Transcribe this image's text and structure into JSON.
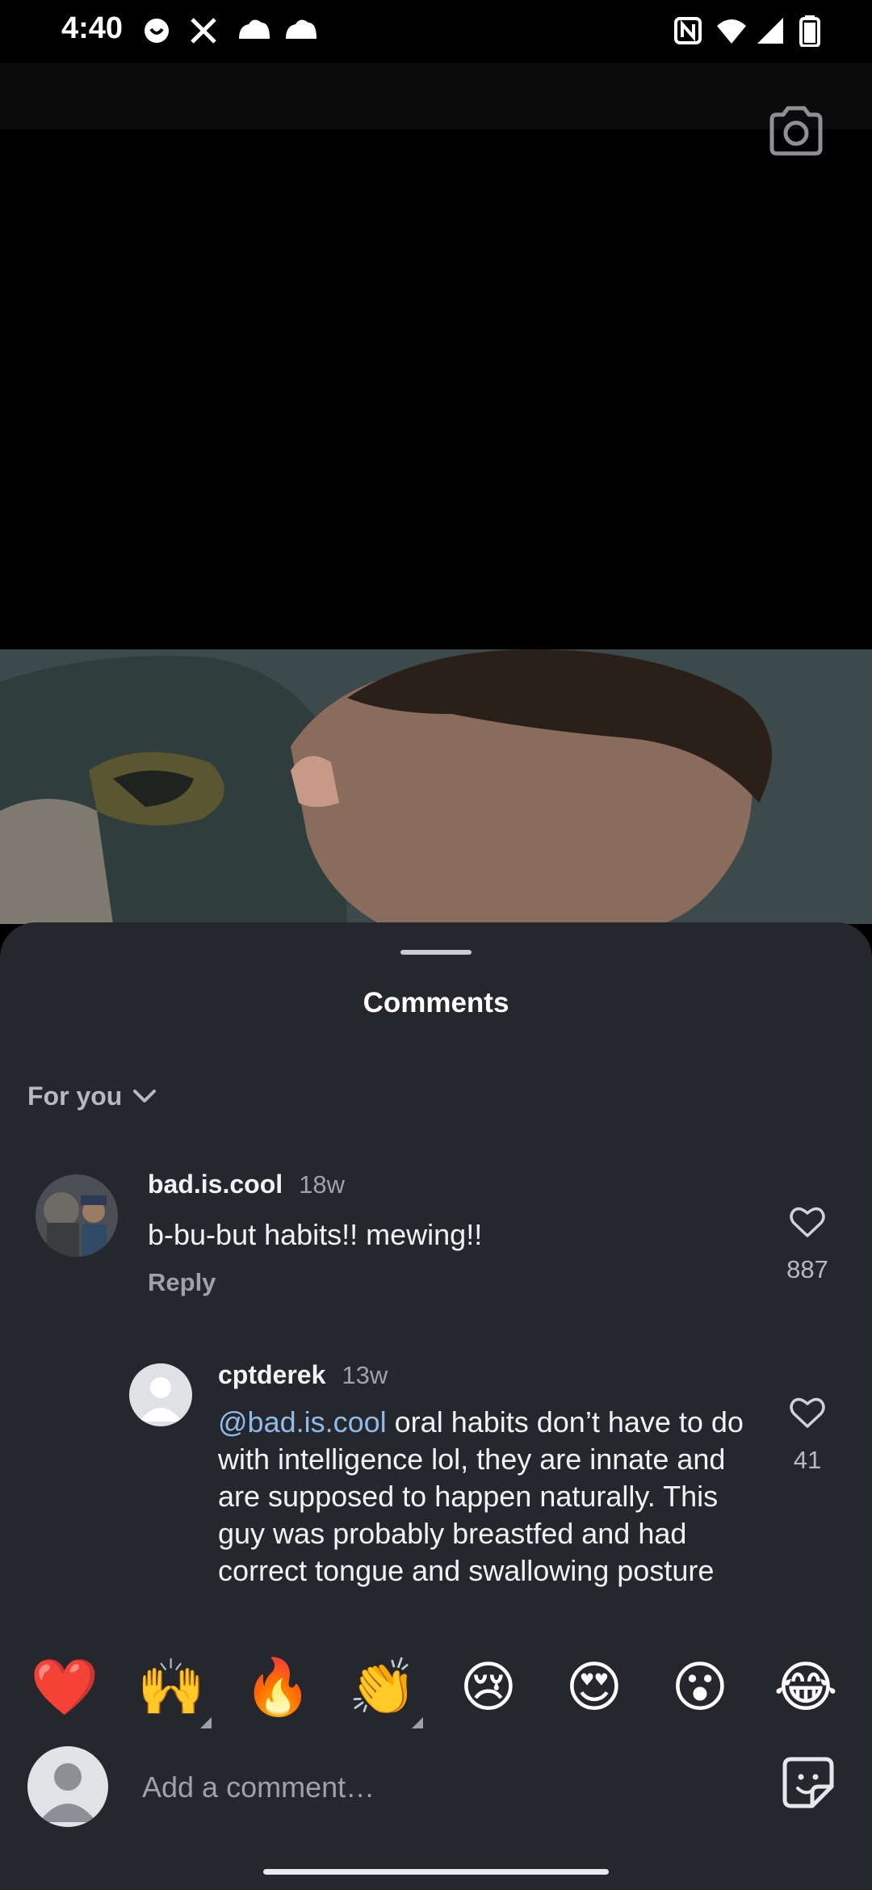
{
  "status_bar": {
    "time": "4:40"
  },
  "sheet": {
    "title": "Comments"
  },
  "sort": {
    "label": "For you"
  },
  "comments": [
    {
      "username": "bad.is.cool",
      "time": "18w",
      "text": "b-bu-but habits!! mewing!!",
      "reply_label": "Reply",
      "likes": "887"
    },
    {
      "username": "cptderek",
      "time": "13w",
      "mention": "@bad.is.cool",
      "text": " oral habits don’t have to do with intelligence lol, they are innate and are supposed to happen naturally. This guy was probably breastfed and had correct tongue and swallowing posture",
      "likes": "41"
    }
  ],
  "emoji_bar": {
    "emojis": [
      "❤️",
      "🙌",
      "🔥",
      "👏",
      "😢",
      "😍",
      "😮",
      "😂"
    ]
  },
  "composer": {
    "placeholder": "Add a comment…"
  },
  "icons": {
    "camera": "camera-icon",
    "heart": "heart-outline-icon",
    "sticker": "sticker-icon",
    "chevron": "chevron-down-icon"
  },
  "colors": {
    "sheet_bg": "#25272d",
    "mention": "#8fbbea",
    "muted": "#9ea1a8"
  }
}
